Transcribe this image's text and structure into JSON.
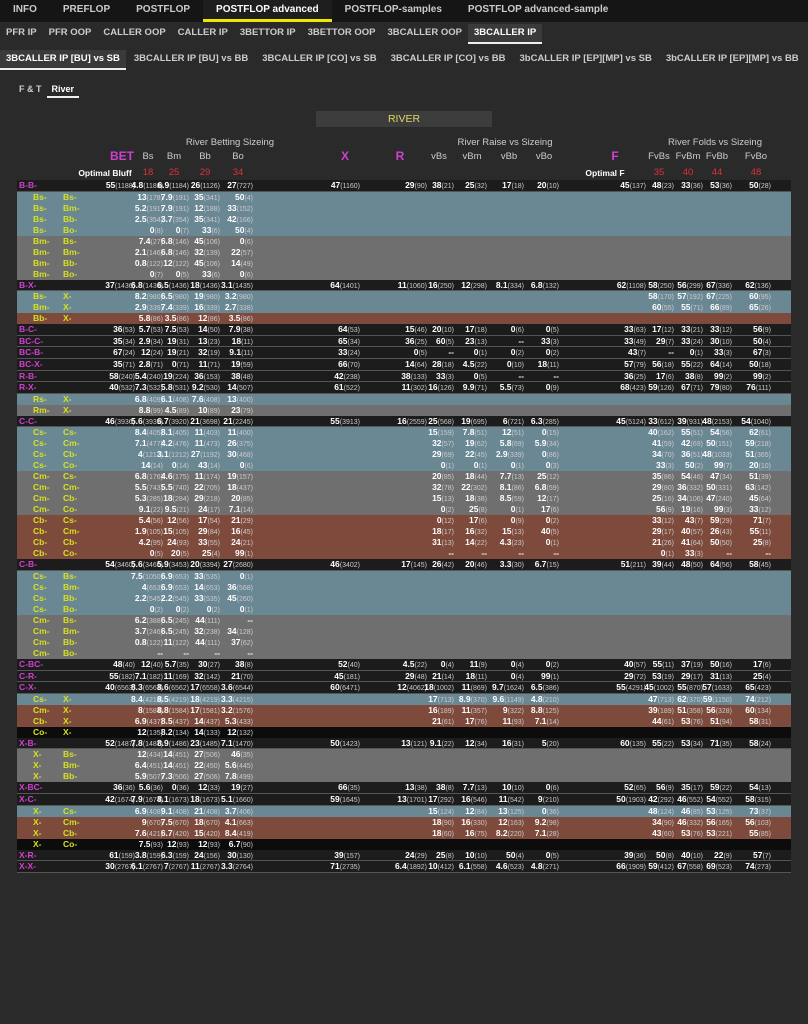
{
  "top_tabs": [
    "INFO",
    "PREFLOP",
    "POSTFLOP",
    "POSTFLOP advanced",
    "POSTFLOP-samples",
    "POSTFLOP advanced-sample"
  ],
  "sub_tabs": [
    "PFR IP",
    "PFR OOP",
    "CALLER OOP",
    "CALLER IP",
    "3BETTOR IP",
    "3BETTOR OOP",
    "3BCALLER OOP",
    "3BCALLER IP"
  ],
  "sub2_tabs": [
    "3BCALLER IP [BU] vs SB",
    "3BCALLER IP [BU] vs BB",
    "3BCALLER IP [CO] vs SB",
    "3BCALLER IP [CO] vs BB",
    "3bCALLER IP [EP][MP] vs SB",
    "3bCALLER IP [EP][MP] vs BB"
  ],
  "sub3_tabs": [
    "F & T",
    "River"
  ],
  "section": "RIVER",
  "headers": {
    "sizing": "River Betting Sizeing",
    "raise": "River Raise vs Sizeing",
    "folds": "River Folds vs Sizeing",
    "bet": "BET",
    "x": "X",
    "r": "R",
    "f": "F",
    "optimal_bluff": "Optimal Bluff",
    "optimal_f": "Optimal F",
    "cols": [
      "Bs",
      "Bm",
      "Bb",
      "Bo",
      "vBs",
      "vBm",
      "vBb",
      "vBo",
      "FvBs",
      "FvBm",
      "FvBb",
      "FvBo"
    ],
    "reds": [
      "18",
      "25",
      "29",
      "34",
      "35",
      "40",
      "44",
      "48"
    ]
  },
  "rows": [
    {
      "k": "main",
      "l": "B-B-",
      "v": [
        "55|1188",
        "4.8|1188",
        "6.9|1184",
        "26|1126",
        "27|727",
        "47|1160",
        "29|90",
        "38|21",
        "25|32",
        "17|18",
        "20|10",
        "45|137",
        "48|23",
        "33|36",
        "53|36",
        "50|28"
      ]
    },
    {
      "k": "blue",
      "h": "Bs-",
      "h2": "Bs-",
      "v": [
        "",
        "13|178",
        "7.9|191",
        "35|341",
        "50|4"
      ]
    },
    {
      "k": "blue",
      "h": "Bs-",
      "h2": "Bm-",
      "v": [
        "",
        "5.2|191",
        "7.9|191",
        "12|188",
        "33|152"
      ]
    },
    {
      "k": "blue",
      "h": "Bs-",
      "h2": "Bb-",
      "v": [
        "",
        "2.5|354",
        "3.7|354",
        "35|341",
        "42|166"
      ]
    },
    {
      "k": "blue",
      "h": "Bs-",
      "h2": "Bo-",
      "v": [
        "",
        "0|8",
        "0|7",
        "33|6",
        "50|4"
      ]
    },
    {
      "k": "grey",
      "h": "Bm-",
      "h2": "Bs-",
      "v": [
        "",
        "7.4|27",
        "6.8|146",
        "45|106",
        "0|6"
      ]
    },
    {
      "k": "grey",
      "h": "Bm-",
      "h2": "Bm-",
      "v": [
        "",
        "2.1|146",
        "6.8|146",
        "32|139",
        "22|57"
      ]
    },
    {
      "k": "grey",
      "h": "Bm-",
      "h2": "Bb-",
      "v": [
        "",
        "0.8|122",
        "12|122",
        "45|106",
        "14|49"
      ]
    },
    {
      "k": "grey",
      "h": "Bm-",
      "h2": "Bo-",
      "v": [
        "",
        "0|7",
        "0|5",
        "33|6",
        "0|6"
      ]
    },
    {
      "k": "main",
      "l": "B-X-",
      "v": [
        "37|1436",
        "6.8|1436",
        "6.5|1436",
        "18|1436",
        "3.1|1435",
        "64|1401",
        "11|1060",
        "16|250",
        "12|298",
        "8.1|334",
        "6.8|132",
        "62|1108",
        "58|250",
        "56|299",
        "67|336",
        "62|136"
      ]
    },
    {
      "k": "blue",
      "h": "Bs-",
      "h2": "X-",
      "v": [
        "",
        "8.2|980",
        "6.5|980",
        "19|980",
        "3.2|980",
        "",
        "",
        "",
        "",
        "",
        "",
        "",
        "58|170",
        "57|192",
        "67|225",
        "60|95"
      ]
    },
    {
      "k": "blue",
      "h": "Bm-",
      "h2": "X-",
      "v": [
        "",
        "2.9|339",
        "7.4|339",
        "16|339",
        "2.7|338",
        "",
        "",
        "",
        "",
        "",
        "",
        "",
        "60|55",
        "55|71",
        "66|89",
        "65|26"
      ]
    },
    {
      "k": "brown",
      "h": "Bb-",
      "h2": "X-",
      "v": [
        "",
        "5.8|86",
        "3.5|86",
        "12|86",
        "3.5|86"
      ]
    },
    {
      "k": "main",
      "l": "B-C-",
      "v": [
        "36|53",
        "5.7|53",
        "7.5|53",
        "14|50",
        "7.9|38",
        "64|53",
        "15|46",
        "20|10",
        "17|18",
        "0|6",
        "0|5",
        "33|63",
        "17|12",
        "33|21",
        "33|12",
        "56|9"
      ]
    },
    {
      "k": "main",
      "l": "BC-C-",
      "v": [
        "35|34",
        "2.9|34",
        "19|31",
        "13|23",
        "18|11",
        "65|34",
        "36|25",
        "60|5",
        "23|13",
        "--",
        "33|3",
        "33|49",
        "29|7",
        "33|24",
        "30|10",
        "50|4"
      ]
    },
    {
      "k": "main",
      "l": "BC-B-",
      "v": [
        "67|24",
        "12|24",
        "19|21",
        "32|19",
        "9.1|11",
        "33|24",
        "0|5",
        "--",
        "0|1",
        "0|2",
        "0|2",
        "43|7",
        "--",
        "0|1",
        "33|3",
        "67|3"
      ]
    },
    {
      "k": "main",
      "l": "BC-X-",
      "v": [
        "35|71",
        "2.8|71",
        "0|71",
        "11|71",
        "19|59",
        "66|70",
        "14|64",
        "28|18",
        "4.5|22",
        "0|10",
        "18|11",
        "57|79",
        "56|18",
        "55|22",
        "64|14",
        "50|18"
      ]
    },
    {
      "k": "main",
      "l": "R-B-",
      "v": [
        "58|240",
        "5.4|240",
        "19|224",
        "36|153",
        "38|48",
        "42|238",
        "38|133",
        "33|3",
        "0|5",
        "--",
        "--",
        "36|25",
        "17|6",
        "38|8",
        "99|2",
        "99|2"
      ]
    },
    {
      "k": "main",
      "l": "R-X-",
      "v": [
        "40|532",
        "7.3|532",
        "5.8|531",
        "9.2|530",
        "14|507",
        "61|522",
        "11|302",
        "16|126",
        "9.9|71",
        "5.5|73",
        "0|9",
        "68|423",
        "59|126",
        "67|71",
        "79|80",
        "76|111"
      ]
    },
    {
      "k": "blue",
      "h": "Rs-",
      "h2": "X-",
      "v": [
        "",
        "6.8|409",
        "6.1|408",
        "7.6|408",
        "13|400"
      ]
    },
    {
      "k": "grey",
      "h": "Rm-",
      "h2": "X-",
      "v": [
        "",
        "8.8|99",
        "4.5|89",
        "10|89",
        "23|79"
      ]
    },
    {
      "k": "main",
      "l": "C-C-",
      "v": [
        "46|3936",
        "5.6|3935",
        "6.7|3920",
        "21|3698",
        "21|2245",
        "55|3913",
        "16|2559",
        "25|568",
        "19|695",
        "6|721",
        "6.3|285",
        "45|5124",
        "33|612",
        "39|931",
        "48|2153",
        "54|1040"
      ]
    },
    {
      "k": "blue",
      "h": "Cs-",
      "h2": "Cs-",
      "v": [
        "",
        "8.4|405",
        "8.1|405",
        "11|403",
        "11|400",
        "",
        "",
        "15|159",
        "7.8|51",
        "12|51",
        "0|15",
        "",
        "40|162",
        "55|51",
        "54|56",
        "62|61"
      ]
    },
    {
      "k": "blue",
      "h": "Cs-",
      "h2": "Cm-",
      "v": [
        "",
        "7.1|477",
        "4.2|476",
        "11|473",
        "26|375",
        "",
        "",
        "32|57",
        "19|62",
        "5.8|69",
        "5.9|34",
        "",
        "41|59",
        "42|69",
        "50|151",
        "59|218"
      ]
    },
    {
      "k": "blue",
      "h": "Cs-",
      "h2": "Cb-",
      "v": [
        "",
        "4|1212",
        "3.1|1212",
        "27|1192",
        "30|468",
        "",
        "",
        "29|69",
        "22|45",
        "2.9|339",
        "0|86",
        "",
        "34|70",
        "36|51",
        "48|1033",
        "51|365"
      ]
    },
    {
      "k": "blue",
      "h": "Cs-",
      "h2": "Co-",
      "v": [
        "",
        "14|14",
        "0|14",
        "43|14",
        "0|6",
        "",
        "",
        "0|1",
        "0|1",
        "0|1",
        "0|3",
        "",
        "33|3",
        "50|2",
        "99|7",
        "20|10"
      ]
    },
    {
      "k": "grey",
      "h": "Cm-",
      "h2": "Cs-",
      "v": [
        "",
        "6.8|176",
        "4.6|175",
        "11|174",
        "19|157",
        "",
        "",
        "20|85",
        "18|44",
        "7.7|13",
        "25|12",
        "",
        "35|86",
        "54|46",
        "47|34",
        "51|39"
      ]
    },
    {
      "k": "grey",
      "h": "Cm-",
      "h2": "Cm-",
      "v": [
        "",
        "5.5|743",
        "5.5|740",
        "22|705",
        "18|437",
        "",
        "",
        "32|78",
        "22|302",
        "8.1|86",
        "6.8|59",
        "",
        "29|80",
        "36|332",
        "50|331",
        "63|142"
      ]
    },
    {
      "k": "grey",
      "h": "Cm-",
      "h2": "Cb-",
      "v": [
        "",
        "5.3|285",
        "18|284",
        "29|218",
        "20|85",
        "",
        "",
        "15|13",
        "18|38",
        "8.5|59",
        "12|17",
        "",
        "25|16",
        "34|106",
        "47|240",
        "45|64"
      ]
    },
    {
      "k": "grey",
      "h": "Cm-",
      "h2": "Co-",
      "v": [
        "",
        "9.1|22",
        "9.5|21",
        "24|17",
        "7.1|14",
        "",
        "",
        "0|2",
        "25|8",
        "0|1",
        "17|6",
        "",
        "56|9",
        "19|16",
        "99|3",
        "33|12"
      ]
    },
    {
      "k": "brown",
      "h": "Cb-",
      "h2": "Cs-",
      "v": [
        "",
        "5.4|56",
        "12|56",
        "17|54",
        "21|29",
        "",
        "",
        "0|12",
        "17|6",
        "0|9",
        "0|2",
        "",
        "33|12",
        "43|7",
        "59|29",
        "71|7"
      ]
    },
    {
      "k": "brown",
      "h": "Cb-",
      "h2": "Cm-",
      "v": [
        "",
        "1.9|105",
        "15|105",
        "29|84",
        "16|45",
        "",
        "",
        "18|17",
        "16|32",
        "15|13",
        "40|5",
        "",
        "29|17",
        "40|57",
        "26|43",
        "55|11"
      ]
    },
    {
      "k": "brown",
      "h": "Cb-",
      "h2": "Cb-",
      "v": [
        "",
        "4.2|95",
        "24|93",
        "33|55",
        "24|21",
        "",
        "",
        "31|13",
        "14|22",
        "4.3|23",
        "0|1",
        "",
        "21|26",
        "41|64",
        "50|50",
        "25|8"
      ]
    },
    {
      "k": "brown",
      "h": "Cb-",
      "h2": "Co-",
      "v": [
        "",
        "0|5",
        "20|5",
        "25|4",
        "99|1",
        "",
        "",
        "--",
        "--",
        "--",
        "--",
        "",
        "0|1",
        "33|3",
        "--",
        "--"
      ]
    },
    {
      "k": "main",
      "l": "C-B-",
      "v": [
        "54|3460",
        "5.6|3460",
        "5.9|3453",
        "20|3394",
        "27|2680",
        "46|3402",
        "17|145",
        "26|42",
        "20|46",
        "3.3|30",
        "6.7|15",
        "51|211",
        "39|44",
        "48|50",
        "64|56",
        "58|45"
      ]
    },
    {
      "k": "blue",
      "h": "Cs-",
      "h2": "Bs-",
      "v": [
        "",
        "7.5|1050",
        "6.9|653",
        "33|535",
        "0|1"
      ]
    },
    {
      "k": "blue",
      "h": "Cs-",
      "h2": "Bm-",
      "v": [
        "",
        "4|653",
        "6.9|653",
        "14|653",
        "36|568"
      ]
    },
    {
      "k": "blue",
      "h": "Cs-",
      "h2": "Bb-",
      "v": [
        "",
        "2.2|545",
        "2.2|545",
        "33|535",
        "45|260"
      ]
    },
    {
      "k": "blue",
      "h": "Cs-",
      "h2": "Bo-",
      "v": [
        "",
        "0|2",
        "0|2",
        "0|2",
        "0|1"
      ]
    },
    {
      "k": "grey",
      "h": "Cm-",
      "h2": "Bs-",
      "v": [
        "",
        "6.2|388",
        "6.5|245",
        "44|111",
        "--"
      ]
    },
    {
      "k": "grey",
      "h": "Cm-",
      "h2": "Bm-",
      "v": [
        "",
        "3.7|246",
        "6.5|245",
        "32|238",
        "34|128"
      ]
    },
    {
      "k": "grey",
      "h": "Cm-",
      "h2": "Bb-",
      "v": [
        "",
        "0.8|122",
        "11|122",
        "44|111",
        "37|62"
      ]
    },
    {
      "k": "grey",
      "h": "Cm-",
      "h2": "Bo-",
      "v": [
        "",
        "--",
        "--",
        "--",
        "--"
      ]
    },
    {
      "k": "main",
      "l": "C-BC-",
      "v": [
        "48|40",
        "12|40",
        "5.7|35",
        "30|27",
        "38|8",
        "52|40",
        "4.5|22",
        "0|4",
        "11|9",
        "0|4",
        "0|2",
        "40|57",
        "55|11",
        "37|19",
        "50|16",
        "17|6"
      ]
    },
    {
      "k": "main",
      "l": "C-R-",
      "v": [
        "55|182",
        "7.1|182",
        "11|169",
        "32|142",
        "21|70",
        "45|181",
        "29|48",
        "21|14",
        "18|11",
        "0|4",
        "99|1",
        "29|72",
        "53|19",
        "29|17",
        "31|13",
        "25|4"
      ]
    },
    {
      "k": "main",
      "l": "C-X-",
      "v": [
        "40|6563",
        "8.3|6563",
        "8.6|6562",
        "17|6558",
        "3.6|6544",
        "60|6471",
        "12|4062",
        "18|1002",
        "11|869",
        "9.7|1624",
        "6.5|386",
        "55|4291",
        "45|1002",
        "55|870",
        "57|1633",
        "65|423"
      ]
    },
    {
      "k": "blue",
      "h": "Cs-",
      "h2": "X-",
      "v": [
        "",
        "8.4|4219",
        "8.5|4219",
        "18|4219",
        "3.3|4215",
        "",
        "",
        "17|713",
        "8.9|370",
        "9.6|1149",
        "4.8|210",
        "",
        "47|713",
        "62|370",
        "59|1150",
        "74|212"
      ]
    },
    {
      "k": "brown",
      "h": "Cm-",
      "h2": "X-",
      "v": [
        "",
        "8|1584",
        "8.8|1584",
        "17|1581",
        "3.2|1576",
        "",
        "",
        "16|189",
        "11|357",
        "9|322",
        "8.8|125",
        "",
        "39|189",
        "51|358",
        "56|328",
        "60|134"
      ]
    },
    {
      "k": "brown",
      "h": "Cb-",
      "h2": "X-",
      "v": [
        "",
        "6.9|437",
        "8.5|437",
        "14|437",
        "5.3|433",
        "",
        "",
        "21|61",
        "17|76",
        "11|93",
        "7.1|14",
        "",
        "44|61",
        "53|76",
        "51|94",
        "58|31"
      ]
    },
    {
      "k": "black",
      "h": "Co-",
      "h2": "X-",
      "v": [
        "",
        "12|135",
        "8.2|134",
        "14|133",
        "12|132"
      ]
    },
    {
      "k": "main",
      "l": "X-B-",
      "v": [
        "52|1487",
        "7.8|1487",
        "8.9|1486",
        "23|1485",
        "7.1|1470",
        "50|1423",
        "13|121",
        "9.1|22",
        "12|34",
        "16|31",
        "5|20",
        "60|135",
        "55|22",
        "53|34",
        "71|35",
        "58|24"
      ]
    },
    {
      "k": "grey",
      "h": "X-",
      "h2": "Bs-",
      "v": [
        "",
        "12|434",
        "14|451",
        "27|506",
        "46|35"
      ]
    },
    {
      "k": "grey",
      "h": "X-",
      "h2": "Bm-",
      "v": [
        "",
        "6.4|451",
        "14|451",
        "22|450",
        "5.6|445"
      ]
    },
    {
      "k": "grey",
      "h": "X-",
      "h2": "Bb-",
      "v": [
        "",
        "5.9|507",
        "7.3|506",
        "27|506",
        "7.8|499"
      ]
    },
    {
      "k": "main",
      "l": "X-BC-",
      "v": [
        "36|36",
        "5.6|36",
        "0|36",
        "12|33",
        "19|27",
        "66|35",
        "13|38",
        "38|8",
        "7.7|13",
        "10|10",
        "0|6",
        "52|65",
        "56|9",
        "35|17",
        "59|22",
        "54|13"
      ]
    },
    {
      "k": "main",
      "l": "X-C-",
      "v": [
        "42|1674",
        "7.9|1674",
        "8.1|1673",
        "18|1673",
        "5.1|1660",
        "59|1645",
        "13|1701",
        "17|292",
        "16|546",
        "11|542",
        "9|210",
        "50|1903",
        "42|292",
        "46|552",
        "54|552",
        "58|315"
      ]
    },
    {
      "k": "blue",
      "h": "X-",
      "h2": "Cs-",
      "v": [
        "",
        "6.9|408",
        "9.1|408",
        "21|408",
        "3.7|406",
        "",
        "",
        "15|124",
        "12|84",
        "13|125",
        "0|36",
        "",
        "48|124",
        "46|85",
        "53|125",
        "73|37"
      ]
    },
    {
      "k": "brown",
      "h": "X-",
      "h2": "Cm-",
      "v": [
        "",
        "9|670",
        "7.5|670",
        "18|670",
        "4.1|663",
        "",
        "",
        "18|90",
        "16|330",
        "12|163",
        "9.2|98",
        "",
        "34|90",
        "46|332",
        "56|165",
        "56|103"
      ]
    },
    {
      "k": "brown",
      "h": "X-",
      "h2": "Cb-",
      "v": [
        "",
        "7.6|421",
        "6.7|420",
        "15|420",
        "8.4|419",
        "",
        "",
        "18|60",
        "16|75",
        "8.2|220",
        "7.1|28",
        "",
        "43|60",
        "53|76",
        "53|221",
        "55|85"
      ]
    },
    {
      "k": "black",
      "h": "X-",
      "h2": "Co-",
      "v": [
        "",
        "7.5|93",
        "12|93",
        "12|93",
        "6.7|90"
      ]
    },
    {
      "k": "main",
      "l": "X-R-",
      "v": [
        "61|159",
        "3.8|159",
        "6.3|159",
        "24|156",
        "30|130",
        "39|157",
        "24|29",
        "25|8",
        "10|10",
        "50|4",
        "0|5",
        "39|36",
        "50|8",
        "40|10",
        "22|9",
        "57|7"
      ]
    },
    {
      "k": "main",
      "l": "X-X-",
      "v": [
        "30|2767",
        "6.1|2767",
        "7|2767",
        "11|2767",
        "3.3|2764",
        "71|2735",
        "6.4|1892",
        "10|412",
        "6.1|558",
        "4.6|523",
        "4.8|271",
        "66|1909",
        "59|412",
        "67|558",
        "69|523",
        "74|273"
      ]
    }
  ]
}
